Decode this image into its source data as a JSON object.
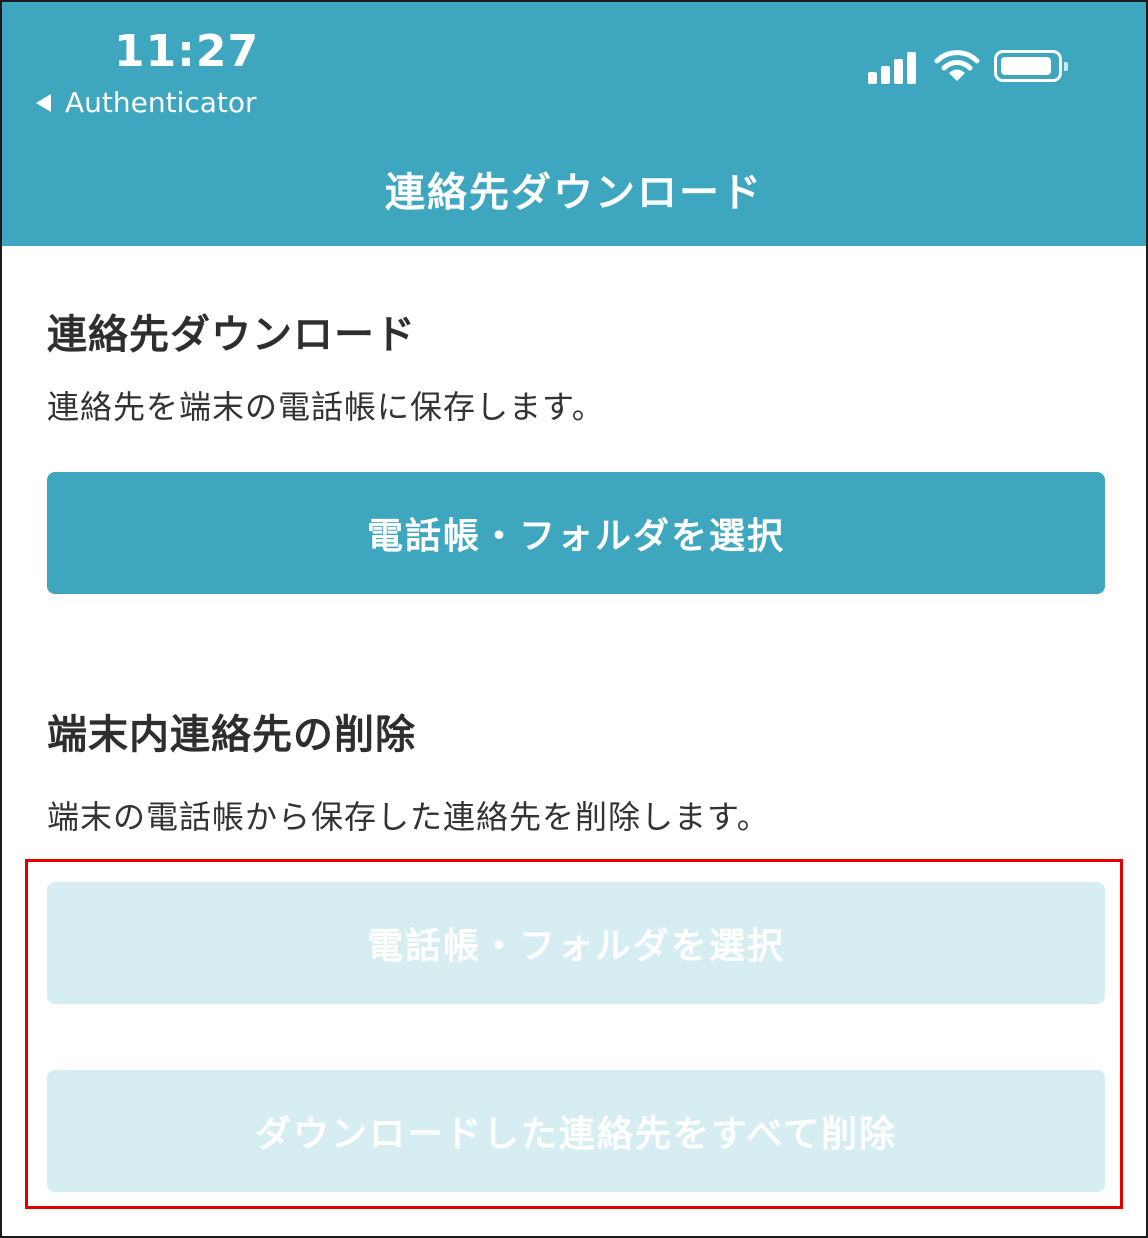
{
  "status_bar": {
    "time": "11:27",
    "back_label": "Authenticator",
    "icons": [
      "cellular-signal-icon",
      "wifi-icon",
      "battery-icon"
    ],
    "battery_level": 0.92
  },
  "nav": {
    "title": "連絡先ダウンロード"
  },
  "download_section": {
    "title": "連絡先ダウンロード",
    "description": "連絡先を端末の電話帳に保存します。",
    "button_label": "電話帳・フォルダを選択"
  },
  "delete_section": {
    "title": "端末内連絡先の削除",
    "description": "端末の電話帳から保存した連絡先を削除します。",
    "select_button_label": "電話帳・フォルダを選択",
    "delete_all_button_label": "ダウンロードした連絡先をすべて削除"
  },
  "colors": {
    "accent": "#3ea6bf",
    "disabled": "#d6edf2",
    "highlight": "#e00000"
  }
}
